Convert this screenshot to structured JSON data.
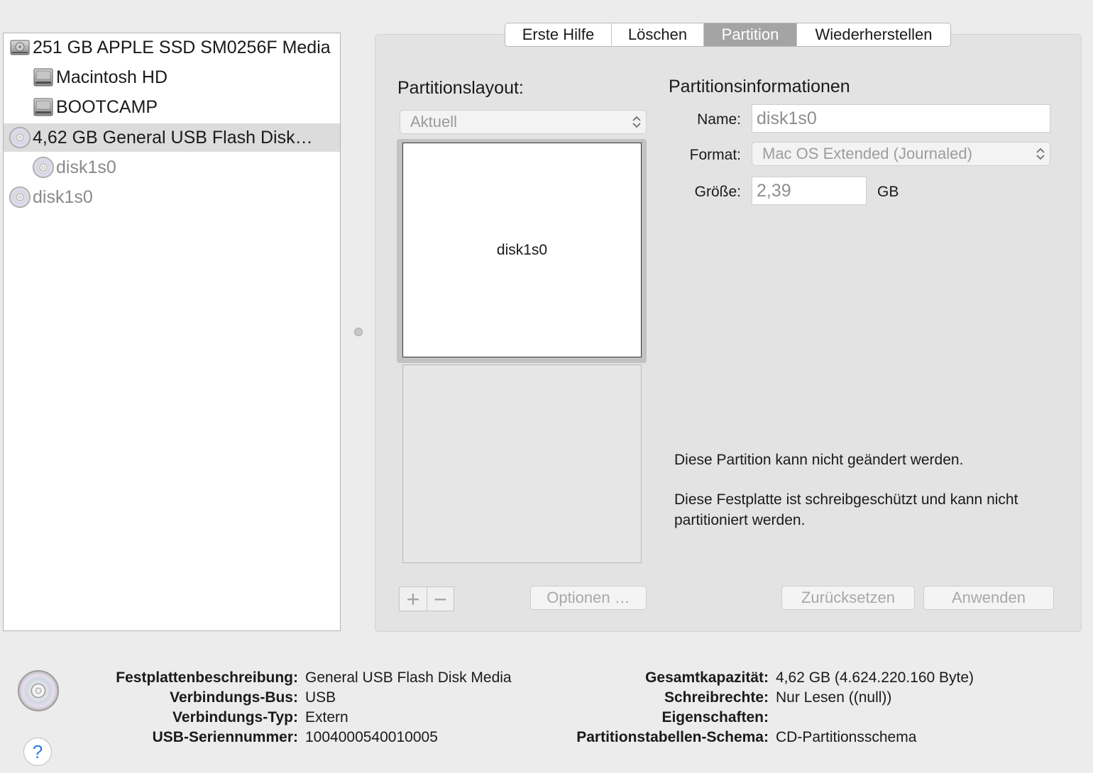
{
  "sidebar": {
    "items": [
      {
        "label": "251 GB APPLE SSD SM0256F Media",
        "icon": "internal-disk-icon",
        "level": 0,
        "selected": false,
        "dim": false
      },
      {
        "label": "Macintosh HD",
        "icon": "volume-disk-icon",
        "level": 1,
        "selected": false,
        "dim": false
      },
      {
        "label": "BOOTCAMP",
        "icon": "volume-disk-icon",
        "level": 1,
        "selected": false,
        "dim": false
      },
      {
        "label": "4,62 GB General USB Flash Disk…",
        "icon": "optical-disc-icon",
        "level": 0,
        "selected": true,
        "dim": false
      },
      {
        "label": "disk1s0",
        "icon": "optical-disc-icon",
        "level": 1,
        "selected": false,
        "dim": true
      },
      {
        "label": "disk1s0",
        "icon": "optical-disc-icon",
        "level": 0,
        "selected": false,
        "dim": true
      }
    ]
  },
  "tabs": [
    {
      "label": "Erste Hilfe",
      "active": false
    },
    {
      "label": "Löschen",
      "active": false
    },
    {
      "label": "Partition",
      "active": true
    },
    {
      "label": "Wiederherstellen",
      "active": false
    }
  ],
  "layout": {
    "title": "Partitionslayout:",
    "select_value": "Aktuell",
    "partition_label": "disk1s0",
    "add_symbol": "+",
    "remove_symbol": "−",
    "options_button": "Optionen …"
  },
  "info": {
    "title": "Partitionsinformationen",
    "name_label": "Name:",
    "name_value": "disk1s0",
    "format_label": "Format:",
    "format_value": "Mac OS Extended (Journaled)",
    "size_label": "Größe:",
    "size_value": "2,39",
    "size_unit": "GB",
    "notice_1": "Diese Partition kann nicht geändert werden.",
    "notice_2": "Diese Festplatte ist schreibgeschützt und kann nicht partitioniert werden.",
    "reset_button": "Zurücksetzen",
    "apply_button": "Anwenden"
  },
  "details": {
    "left": [
      {
        "key": "Festplattenbeschreibung",
        "value": "General USB Flash Disk Media"
      },
      {
        "key": "Verbindungs-Bus",
        "value": "USB"
      },
      {
        "key": "Verbindungs-Typ",
        "value": "Extern"
      },
      {
        "key": "USB-Seriennummer",
        "value": "1004000540010005"
      }
    ],
    "right": [
      {
        "key": "Gesamtkapazität",
        "value": "4,62 GB (4.624.220.160 Byte)"
      },
      {
        "key": "Schreibrechte",
        "value": "Nur Lesen ((null))"
      },
      {
        "key": "Eigenschaften",
        "value": ""
      },
      {
        "key": "Partitionstabellen-Schema",
        "value": "CD-Partitionsschema"
      }
    ],
    "help_symbol": "?"
  }
}
